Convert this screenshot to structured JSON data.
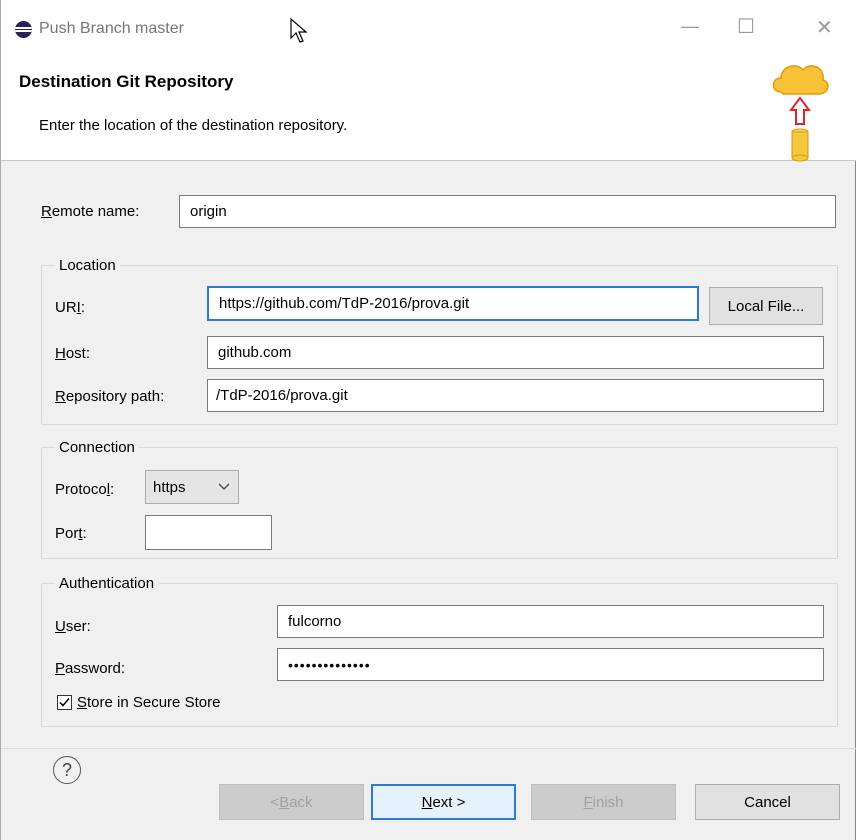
{
  "window": {
    "title": "Push Branch master",
    "minimize_glyph": "—",
    "maximize_glyph": "☐",
    "close_glyph": "✕"
  },
  "header": {
    "title": "Destination Git Repository",
    "description": "Enter the location of the destination repository.",
    "icon": "cloud-push-icon"
  },
  "remote": {
    "label_underlined": "R",
    "label_rest": "emote name:",
    "value": "origin"
  },
  "location": {
    "legend": "Location",
    "uri_label_pre": "UR",
    "uri_label_underlined": "I",
    "uri_label_post": ":",
    "uri_value": "https://github.com/TdP-2016/prova.git",
    "local_file_button": "Local File...",
    "host_label_underlined": "H",
    "host_label_rest": "ost:",
    "host_value": "github.com",
    "repo_label_underlined": "R",
    "repo_label_rest": "epository path:",
    "repo_value": "/TdP-2016/prova.git"
  },
  "connection": {
    "legend": "Connection",
    "protocol_label_pre": "Protoco",
    "protocol_label_underlined": "l",
    "protocol_label_post": ":",
    "protocol_value": "https",
    "port_label_pre": "Por",
    "port_label_underlined": "t",
    "port_label_post": ":",
    "port_value": ""
  },
  "authentication": {
    "legend": "Authentication",
    "user_label_underlined": "U",
    "user_label_rest": "ser:",
    "user_value": "fulcorno",
    "password_label_underlined": "P",
    "password_label_rest": "assword:",
    "password_value": "••••••••••••••",
    "store_underlined": "S",
    "store_rest": "tore in Secure Store",
    "store_checked": true
  },
  "footer": {
    "help_glyph": "?",
    "back_pre": "< ",
    "back_underlined": "B",
    "back_rest": "ack",
    "next_underlined": "N",
    "next_rest": "ext >",
    "finish_underlined": "F",
    "finish_rest": "inish",
    "cancel": "Cancel"
  }
}
